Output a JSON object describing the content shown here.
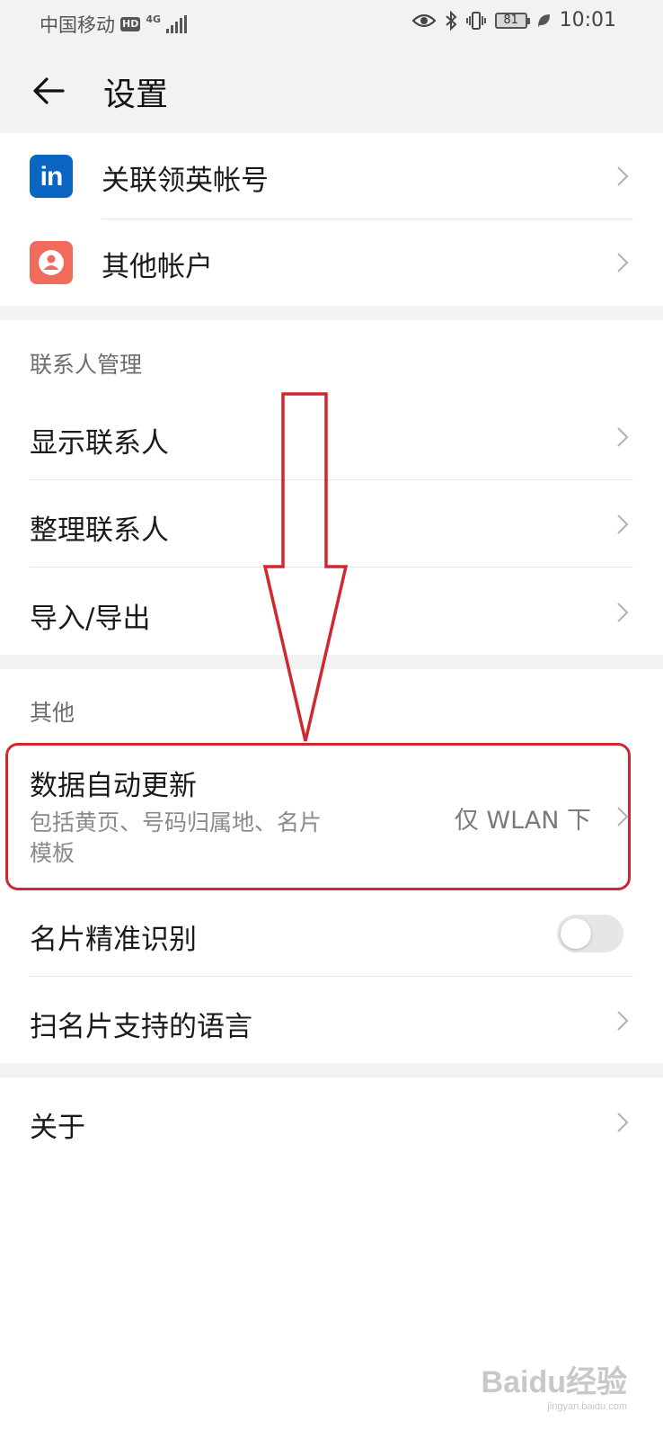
{
  "status_bar": {
    "carrier": "中国移动",
    "hd": "HD",
    "network": "4G",
    "battery": "81",
    "time": "10:01"
  },
  "header": {
    "title": "设置"
  },
  "accounts": {
    "linkedin_icon_text": "in",
    "linkedin_label": "关联领英帐号",
    "other_accounts_label": "其他帐户"
  },
  "contacts_management": {
    "section_title": "联系人管理",
    "items": [
      "显示联系人",
      "整理联系人",
      "导入/导出"
    ]
  },
  "other": {
    "section_title": "其他",
    "auto_update_title": "数据自动更新",
    "auto_update_desc_line1": "包括黄页、号码归属地、名片",
    "auto_update_desc_line2": "模板",
    "auto_update_value": "仅 WLAN 下",
    "card_recognition_label": "名片精准识别",
    "card_recognition_enabled": false,
    "scan_languages_label": "扫名片支持的语言"
  },
  "about": {
    "label": "关于"
  },
  "watermark": {
    "brand": "Baidu经验",
    "url": "jingyan.baidu.com"
  },
  "colors": {
    "background_gray": "#f2f2f2",
    "linkedin_blue": "#0a66c2",
    "account_red": "#f06b5b",
    "annotation_red": "#d1282f"
  }
}
